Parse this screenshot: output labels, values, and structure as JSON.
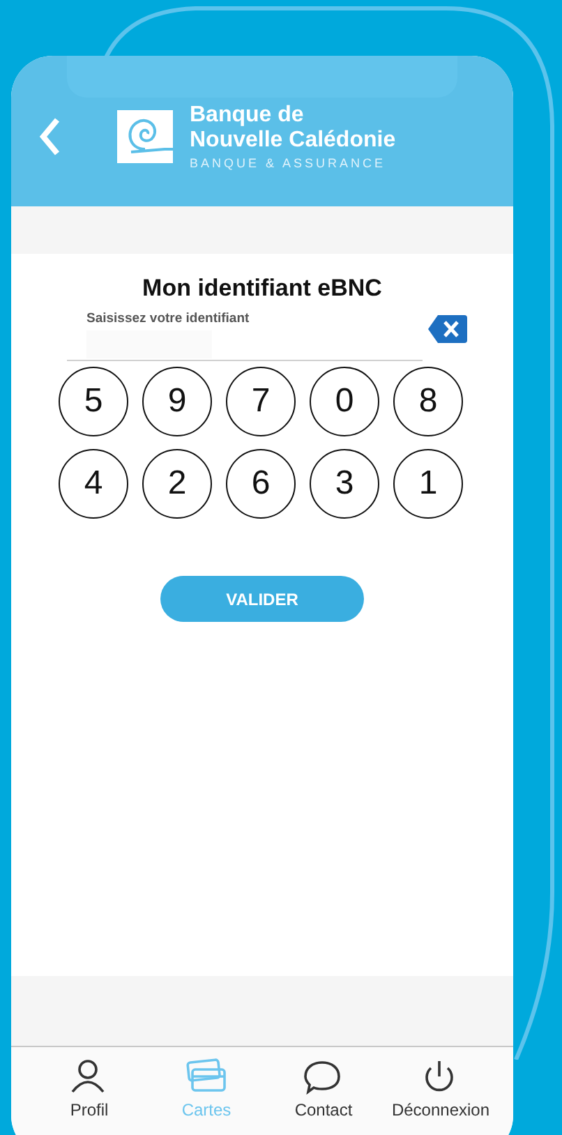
{
  "header": {
    "bank_name_line1": "Banque de",
    "bank_name_line2": "Nouvelle Calédonie",
    "tagline": "BANQUE & ASSURANCE"
  },
  "title": "Mon identifiant eBNC",
  "identifier_field": {
    "label": "Saisissez votre identifiant"
  },
  "keypad": {
    "rows": [
      [
        "5",
        "9",
        "7",
        "0",
        "8"
      ],
      [
        "4",
        "2",
        "6",
        "3",
        "1"
      ]
    ]
  },
  "submit_button": "VALIDER",
  "nav": [
    {
      "label": "Profil",
      "kind": "person",
      "selected": false
    },
    {
      "label": "Cartes",
      "kind": "cards",
      "selected": true
    },
    {
      "label": "Contact",
      "kind": "chat",
      "selected": false
    },
    {
      "label": "Déconnexion",
      "kind": "power",
      "selected": false
    }
  ]
}
